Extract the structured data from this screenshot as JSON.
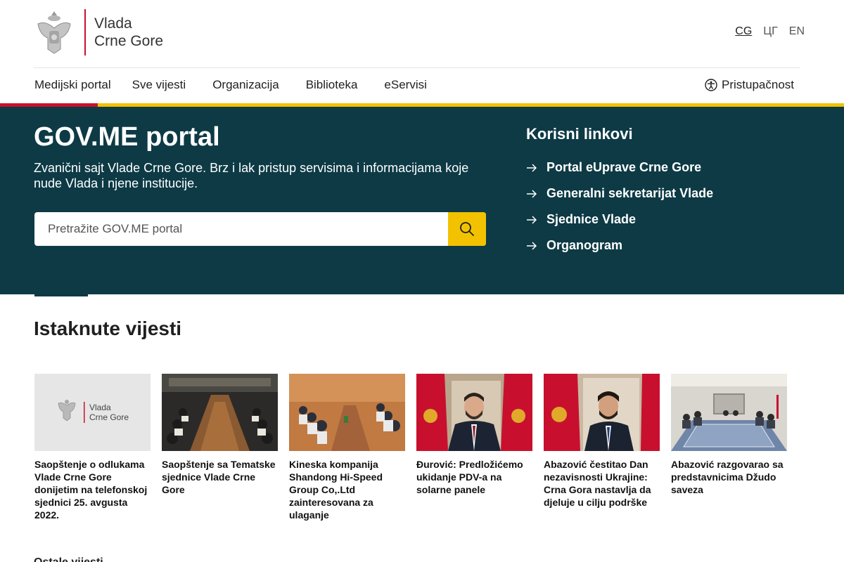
{
  "logo": {
    "line1": "Vlada",
    "line2": "Crne Gore"
  },
  "languages": [
    {
      "label": "CG",
      "active": true
    },
    {
      "label": "ЦГ",
      "active": false
    },
    {
      "label": "EN",
      "active": false
    }
  ],
  "nav": {
    "items": [
      "Medijski portal",
      "Sve vijesti",
      "Organizacija",
      "Biblioteka",
      "eServisi"
    ],
    "accessibility": "Pristupačnost"
  },
  "hero": {
    "title": "GOV.ME portal",
    "description": "Zvanični sajt Vlade Crne Gore. Brz i lak pristup servisima i informacijama koje nude Vlada i njene institucije.",
    "search_placeholder": "Pretražite GOV.ME portal"
  },
  "useful_links": {
    "title": "Korisni linkovi",
    "items": [
      "Portal eUprave Crne Gore",
      "Generalni sekretarijat Vlade",
      "Sjednice Vlade",
      "Organogram"
    ]
  },
  "featured": {
    "title": "Istaknute vijesti",
    "cards": [
      {
        "caption": "Saopštenje o odlukama Vlade Crne Gore donijetim na telefonskoj sjednici 25. avgusta 2022.",
        "thumb_logo_line1": "Vlada",
        "thumb_logo_line2": "Crne Gore"
      },
      {
        "caption": "Saopštenje sa Tematske sjednice Vlade Crne Gore"
      },
      {
        "caption": "Kineska kompanija Shandong Hi-Speed Group Co,.Ltd zainteresovana za ulaganje"
      },
      {
        "caption": "Đurović: Predložićemo ukidanje PDV-a na solarne panele"
      },
      {
        "caption": "Abazović čestitao Dan nezavisnosti Ukrajine: Crna Gora nastavlja da djeluje u cilju podrške"
      },
      {
        "caption": "Abazović razgovarao sa predstavnicima Džudo saveza"
      }
    ]
  },
  "more_label": "Ostale vijesti",
  "colors": {
    "primary": "#0d3a45",
    "accent_yellow": "#f2c200",
    "accent_red": "#c8102e"
  }
}
